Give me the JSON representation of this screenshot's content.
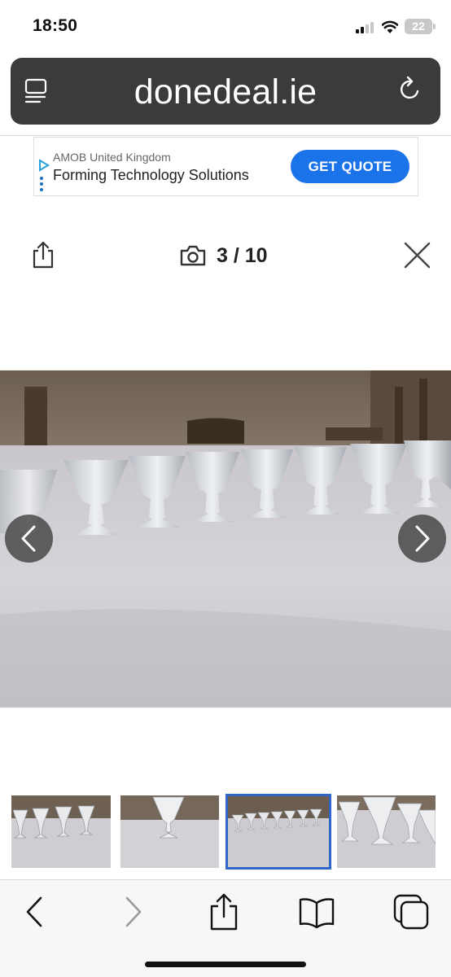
{
  "status_bar": {
    "time": "18:50",
    "battery": "22"
  },
  "browser": {
    "address": "donedeal.ie"
  },
  "ad": {
    "sponsor": "AMOB United Kingdom",
    "headline": "Forming Technology Solutions",
    "cta_label": "GET QUOTE",
    "cta_color": "#1a73e8"
  },
  "gallery": {
    "counter": "3 / 10",
    "current_index": 3,
    "total": 10,
    "thumbnails_visible": 4,
    "active_thumbnail": 3,
    "accent_color": "#2f66c8"
  },
  "icons": {
    "reader": "reader-icon",
    "reload": "reload-icon",
    "share": "share-icon",
    "camera": "camera-icon",
    "close": "close-icon",
    "prev": "chevron-left-icon",
    "next": "chevron-right-icon",
    "back": "back-icon",
    "forward": "forward-icon",
    "bookmarks": "book-icon",
    "tabs": "tabs-icon"
  }
}
